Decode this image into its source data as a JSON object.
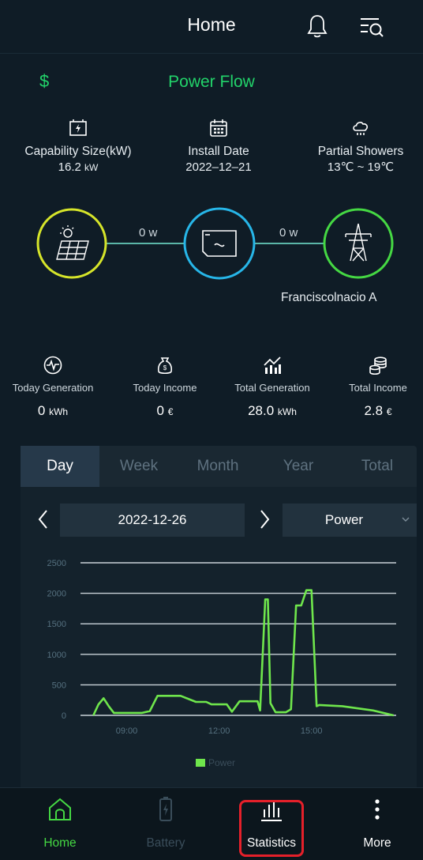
{
  "header": {
    "title": "Home",
    "icons": [
      "bell-icon",
      "search-list-icon"
    ]
  },
  "power_flow": {
    "currency_symbol": "$",
    "title": "Power Flow",
    "info": [
      {
        "icon": "inverter-battery-icon",
        "label": "Capability Size(kW)",
        "value": "16.2",
        "unit": "kW"
      },
      {
        "icon": "calendar-icon",
        "label": "Install Date",
        "value": "2022–12–21",
        "unit": ""
      },
      {
        "icon": "cloud-rain-icon",
        "label": "Partial Showers",
        "value": "13℃ ~ 19℃",
        "unit": ""
      }
    ],
    "left_flow": "0 w",
    "right_flow": "0 w",
    "grid_name": "Franciscolnacio A",
    "colors": {
      "solar": "#d6e52a",
      "inverter": "#27b6e8",
      "grid": "#45d843",
      "line": "#5bb6a8",
      "accent": "#22d36a"
    }
  },
  "stats": [
    {
      "icon": "generation-gauge-icon",
      "label": "Today Generation",
      "value": "0",
      "unit": "kWh"
    },
    {
      "icon": "money-bag-icon",
      "label": "Today Income",
      "value": "0",
      "unit": "€"
    },
    {
      "icon": "growth-chart-icon",
      "label": "Total Generation",
      "value": "28.0",
      "unit": "kWh"
    },
    {
      "icon": "coins-icon",
      "label": "Total Income",
      "value": "2.8",
      "unit": "€"
    }
  ],
  "tabs": [
    {
      "label": "Day",
      "active": true
    },
    {
      "label": "Week",
      "active": false
    },
    {
      "label": "Month",
      "active": false
    },
    {
      "label": "Year",
      "active": false
    },
    {
      "label": "Total",
      "active": false
    }
  ],
  "date_selector": {
    "date": "2022-12-26",
    "metric": "Power"
  },
  "chart_data": {
    "type": "line",
    "title": "",
    "xlabel": "",
    "ylabel": "",
    "ylim": [
      0,
      2500
    ],
    "y_ticks": [
      "0",
      "500",
      "1000",
      "1500",
      "2000",
      "2500"
    ],
    "x_ticks": [
      "09:00",
      "12:00",
      "15:00"
    ],
    "grid": true,
    "legend": "bottom-center",
    "series": [
      {
        "name": "Power",
        "color": "#6fe64c",
        "x": [
          "07:55",
          "08:05",
          "08:15",
          "08:25",
          "08:35",
          "09:00",
          "09:30",
          "09:45",
          "10:00",
          "10:30",
          "10:45",
          "11:15",
          "11:35",
          "11:45",
          "12:15",
          "12:25",
          "12:40",
          "13:05",
          "13:15",
          "13:20",
          "13:30",
          "13:35",
          "13:40",
          "13:50",
          "14:10",
          "14:20",
          "14:30",
          "14:40",
          "14:50",
          "15:00",
          "15:10",
          "15:15",
          "16:00",
          "17:00",
          "17:40"
        ],
        "values": [
          0,
          180,
          280,
          150,
          40,
          40,
          40,
          70,
          320,
          320,
          320,
          220,
          220,
          180,
          180,
          60,
          230,
          230,
          230,
          80,
          1900,
          1900,
          200,
          50,
          50,
          100,
          1800,
          1800,
          2050,
          2050,
          150,
          170,
          150,
          80,
          0
        ]
      }
    ]
  },
  "bottom_nav": [
    {
      "icon": "home-icon",
      "label": "Home",
      "active": true
    },
    {
      "icon": "battery-icon",
      "label": "Battery",
      "active": false
    },
    {
      "icon": "bar-chart-icon",
      "label": "Statistics",
      "active": false
    },
    {
      "icon": "more-vertical-icon",
      "label": "More",
      "active": false
    }
  ]
}
